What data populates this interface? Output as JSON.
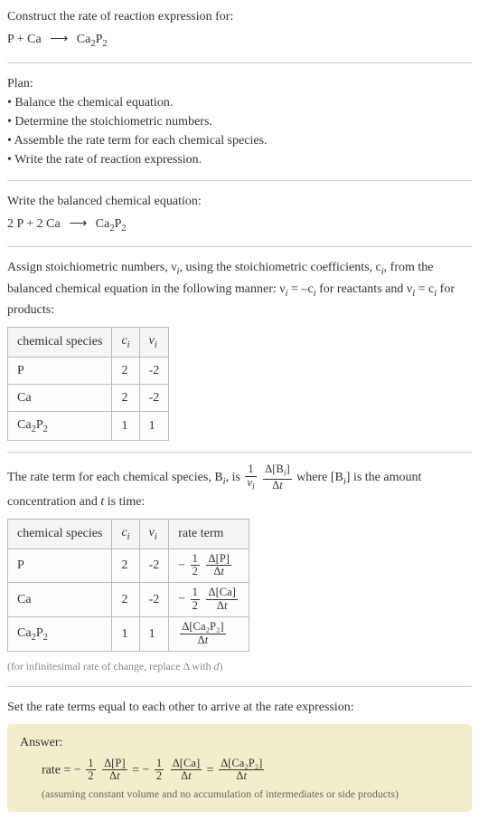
{
  "intro": {
    "prompt": "Construct the rate of reaction expression for:",
    "equation_left": "P + Ca",
    "equation_arrow": "⟶",
    "equation_right": "Ca",
    "equation_right_sub1": "2",
    "equation_right_mid": "P",
    "equation_right_sub2": "2"
  },
  "plan": {
    "title": "Plan:",
    "items": [
      "Balance the chemical equation.",
      "Determine the stoichiometric numbers.",
      "Assemble the rate term for each chemical species.",
      "Write the rate of reaction expression."
    ]
  },
  "balanced": {
    "title": "Write the balanced chemical equation:",
    "left": "2 P + 2 Ca",
    "arrow": "⟶",
    "right": "Ca",
    "right_sub1": "2",
    "right_mid": "P",
    "right_sub2": "2"
  },
  "stoich": {
    "desc_part1": "Assign stoichiometric numbers, ν",
    "desc_sub1": "i",
    "desc_part2": ", using the stoichiometric coefficients, c",
    "desc_sub2": "i",
    "desc_part3": ", from the balanced chemical equation in the following manner: ν",
    "desc_sub3": "i",
    "desc_part4": " = –c",
    "desc_sub4": "i",
    "desc_part5": " for reactants and ν",
    "desc_sub5": "i",
    "desc_part6": " = c",
    "desc_sub6": "i",
    "desc_part7": " for products:",
    "table": {
      "headers": [
        "chemical species",
        "c_i",
        "ν_i"
      ],
      "rows": [
        {
          "species": "P",
          "ci": "2",
          "vi": "-2"
        },
        {
          "species": "Ca",
          "ci": "2",
          "vi": "-2"
        },
        {
          "species": "Ca2P2",
          "ci": "1",
          "vi": "1"
        }
      ]
    }
  },
  "rateterm": {
    "desc_part1": "The rate term for each chemical species, B",
    "desc_sub1": "i",
    "desc_part2": ", is ",
    "frac1_num": "1",
    "frac1_den_prefix": "ν",
    "frac1_den_sub": "i",
    "frac2_num_prefix": "Δ[B",
    "frac2_num_sub": "i",
    "frac2_num_suffix": "]",
    "frac2_den": "Δt",
    "desc_part3": " where [B",
    "desc_sub2": "i",
    "desc_part4": "] is the amount concentration and ",
    "desc_t": "t",
    "desc_part5": " is time:",
    "table": {
      "headers": [
        "chemical species",
        "c_i",
        "ν_i",
        "rate term"
      ],
      "rows": [
        {
          "species": "P",
          "ci": "2",
          "vi": "-2",
          "rate_sign": "−",
          "rate_frac1_num": "1",
          "rate_frac1_den": "2",
          "rate_frac2_num": "Δ[P]",
          "rate_frac2_den": "Δt"
        },
        {
          "species": "Ca",
          "ci": "2",
          "vi": "-2",
          "rate_sign": "−",
          "rate_frac1_num": "1",
          "rate_frac1_den": "2",
          "rate_frac2_num": "Δ[Ca]",
          "rate_frac2_den": "Δt"
        },
        {
          "species": "Ca2P2",
          "ci": "1",
          "vi": "1",
          "rate_sign": "",
          "rate_frac1_num": "",
          "rate_frac1_den": "",
          "rate_frac2_num": "Δ[Ca₂P₂]",
          "rate_frac2_den": "Δt"
        }
      ]
    },
    "note_part1": "(for infinitesimal rate of change, replace Δ with ",
    "note_d": "d",
    "note_part2": ")"
  },
  "final": {
    "title": "Set the rate terms equal to each other to arrive at the rate expression:",
    "answer_label": "Answer:",
    "rate_label": "rate = ",
    "neg": "−",
    "half_num": "1",
    "half_den": "2",
    "term1_num": "Δ[P]",
    "term1_den": "Δt",
    "eq": " = ",
    "term2_num": "Δ[Ca]",
    "term2_den": "Δt",
    "term3_num": "Δ[Ca₂P₂]",
    "term3_den": "Δt",
    "note": "(assuming constant volume and no accumulation of intermediates or side products)"
  }
}
